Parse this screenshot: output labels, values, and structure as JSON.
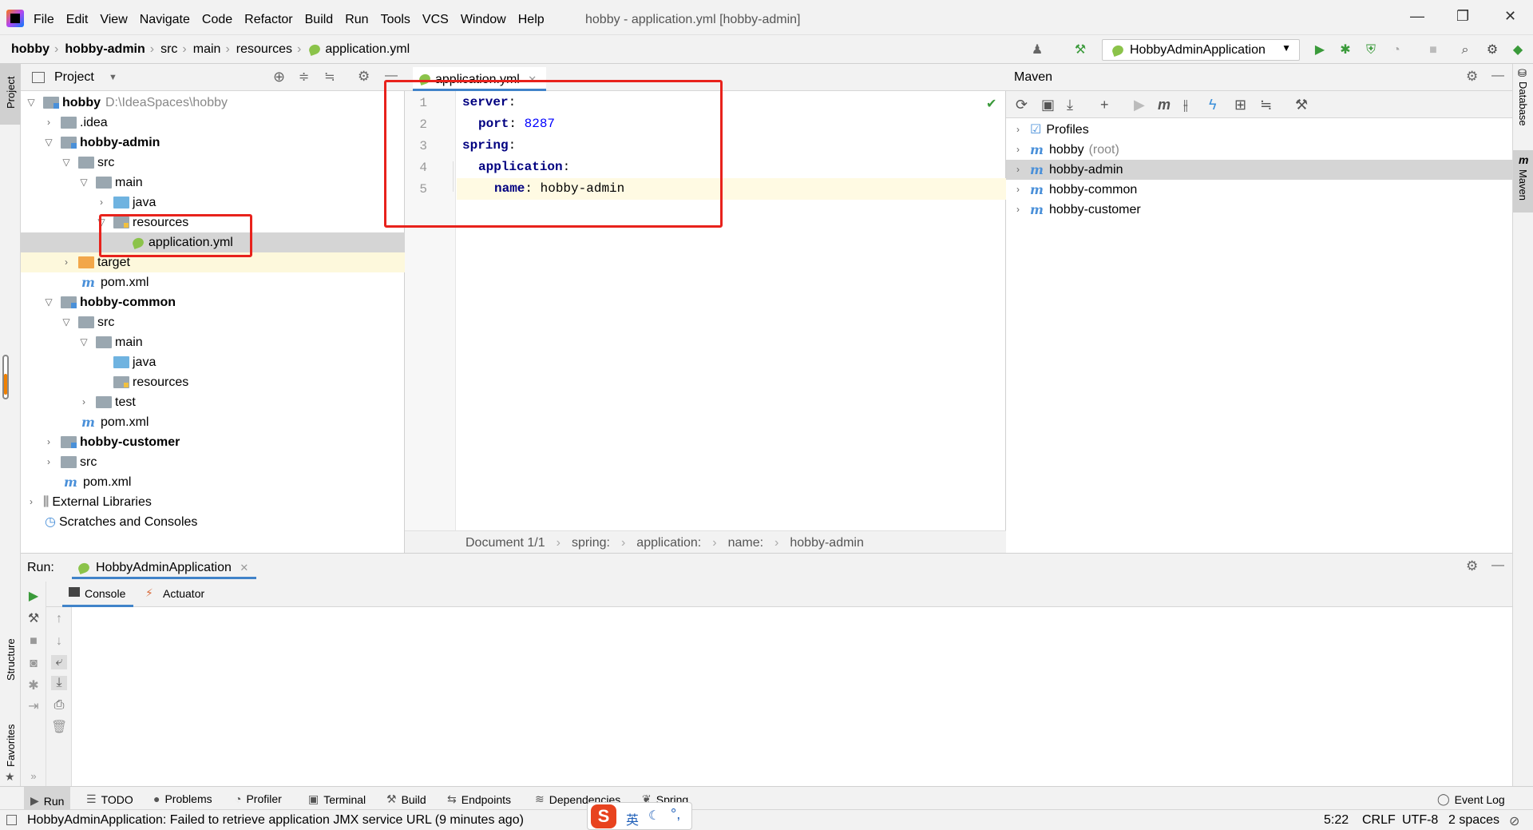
{
  "window": {
    "title": "hobby - application.yml [hobby-admin]",
    "menu": [
      "File",
      "Edit",
      "View",
      "Navigate",
      "Code",
      "Refactor",
      "Build",
      "Run",
      "Tools",
      "VCS",
      "Window",
      "Help"
    ],
    "controls": {
      "minimize": "—",
      "maximize": "❐",
      "close": "✕"
    }
  },
  "navbar": {
    "crumbs": [
      "hobby",
      "hobby-admin",
      "src",
      "main",
      "resources",
      "application.yml"
    ],
    "run_config": "HobbyAdminApplication"
  },
  "left_stripe": {
    "project": "Project",
    "structure": "Structure",
    "favorites": "Favorites"
  },
  "right_stripe": {
    "database": "Database",
    "maven": "Maven"
  },
  "project": {
    "header": "Project",
    "tree": [
      {
        "label": "hobby",
        "extra": "D:\\IdeaSpaces\\hobby"
      },
      {
        "label": ".idea"
      },
      {
        "label": "hobby-admin"
      },
      {
        "label": "src"
      },
      {
        "label": "main"
      },
      {
        "label": "java"
      },
      {
        "label": "resources"
      },
      {
        "label": "application.yml"
      },
      {
        "label": "target"
      },
      {
        "label": "pom.xml"
      },
      {
        "label": "hobby-common"
      },
      {
        "label": "src"
      },
      {
        "label": "main"
      },
      {
        "label": "java"
      },
      {
        "label": "resources"
      },
      {
        "label": "test"
      },
      {
        "label": "pom.xml"
      },
      {
        "label": "hobby-customer"
      },
      {
        "label": "src"
      },
      {
        "label": "pom.xml"
      },
      {
        "label": "External Libraries"
      },
      {
        "label": "Scratches and Consoles"
      }
    ]
  },
  "editor": {
    "tab": "application.yml",
    "line_numbers": [
      "1",
      "2",
      "3",
      "4",
      "5"
    ],
    "lines": [
      {
        "key": "server",
        "sep": ":",
        "value": ""
      },
      {
        "key": "port",
        "sep": ":",
        "value": "8287"
      },
      {
        "key": "spring",
        "sep": ":",
        "value": ""
      },
      {
        "key": "application",
        "sep": ":",
        "value": ""
      },
      {
        "key": "name",
        "sep": ":",
        "value": "hobby-admin"
      }
    ],
    "breadcrumb": [
      "Document 1/1",
      "spring:",
      "application:",
      "name:",
      "hobby-admin"
    ]
  },
  "maven": {
    "header": "Maven",
    "items": [
      {
        "label": "Profiles",
        "extra": ""
      },
      {
        "label": "hobby",
        "extra": "(root)"
      },
      {
        "label": "hobby-admin",
        "extra": ""
      },
      {
        "label": "hobby-common",
        "extra": ""
      },
      {
        "label": "hobby-customer",
        "extra": ""
      }
    ]
  },
  "run": {
    "label": "Run:",
    "tab": "HobbyAdminApplication",
    "subtabs": [
      "Console",
      "Actuator"
    ]
  },
  "bottom_tools": [
    "Run",
    "TODO",
    "Problems",
    "Profiler",
    "Terminal",
    "Build",
    "Endpoints",
    "Dependencies",
    "Spring",
    "Event Log"
  ],
  "status": {
    "message": "HobbyAdminApplication: Failed to retrieve application JMX service URL (9 minutes ago)",
    "position": "5:22",
    "line_sep": "CRLF",
    "encoding": "UTF-8",
    "indent": "2 spaces"
  },
  "ime": {
    "lang": "英"
  },
  "colors": {
    "accent": "#4083c9",
    "highlight_box": "#e8221c",
    "selection": "#d5d5d5"
  }
}
